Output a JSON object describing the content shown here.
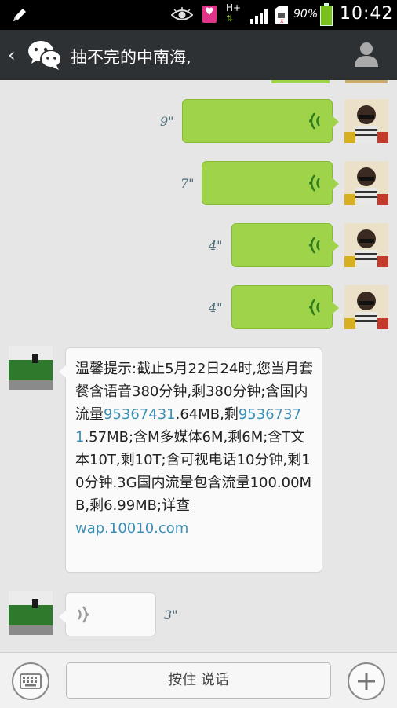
{
  "status_bar": {
    "network": "H+",
    "battery": "90%",
    "time": "10:42",
    "icons": [
      "pen-icon",
      "eye-icon",
      "app-badge-icon",
      "signal-icon",
      "sim-icon",
      "battery-icon"
    ]
  },
  "header": {
    "title": "抽不完的中南海,",
    "back_icon": "chevron-left-icon",
    "logo_icon": "wechat-icon",
    "profile_icon": "person-icon"
  },
  "chat": {
    "voice_messages_sent": [
      {
        "duration": "9\""
      },
      {
        "duration": "7\""
      },
      {
        "duration": "4\""
      },
      {
        "duration": "4\""
      }
    ],
    "sms": {
      "part1": "温馨提示:截止5月22日24时,您当月套餐含语音380分钟,剩380分钟;含国内流量",
      "num1": "95367431",
      "part2": ".64MB,剩",
      "num2": "95367371",
      "part3": ".57MB;含M多媒体6M,剩6M;含T文本10T,剩10T;含可视电话10分钟,剩10分钟.3G国内流量包含流量100.00MB,剩6.99MB;详查",
      "link": "wap.10010.com"
    },
    "voice_message_received": {
      "duration": "3\""
    }
  },
  "bottom_bar": {
    "hold_to_talk": "按住 说话",
    "keyboard_icon": "keyboard-icon",
    "plus_icon": "plus-icon"
  },
  "colors": {
    "sent_bubble": "#9fd34a",
    "received_bubble": "#fafafa",
    "header_bg": "#2e3133",
    "link": "#3b8fb5"
  }
}
